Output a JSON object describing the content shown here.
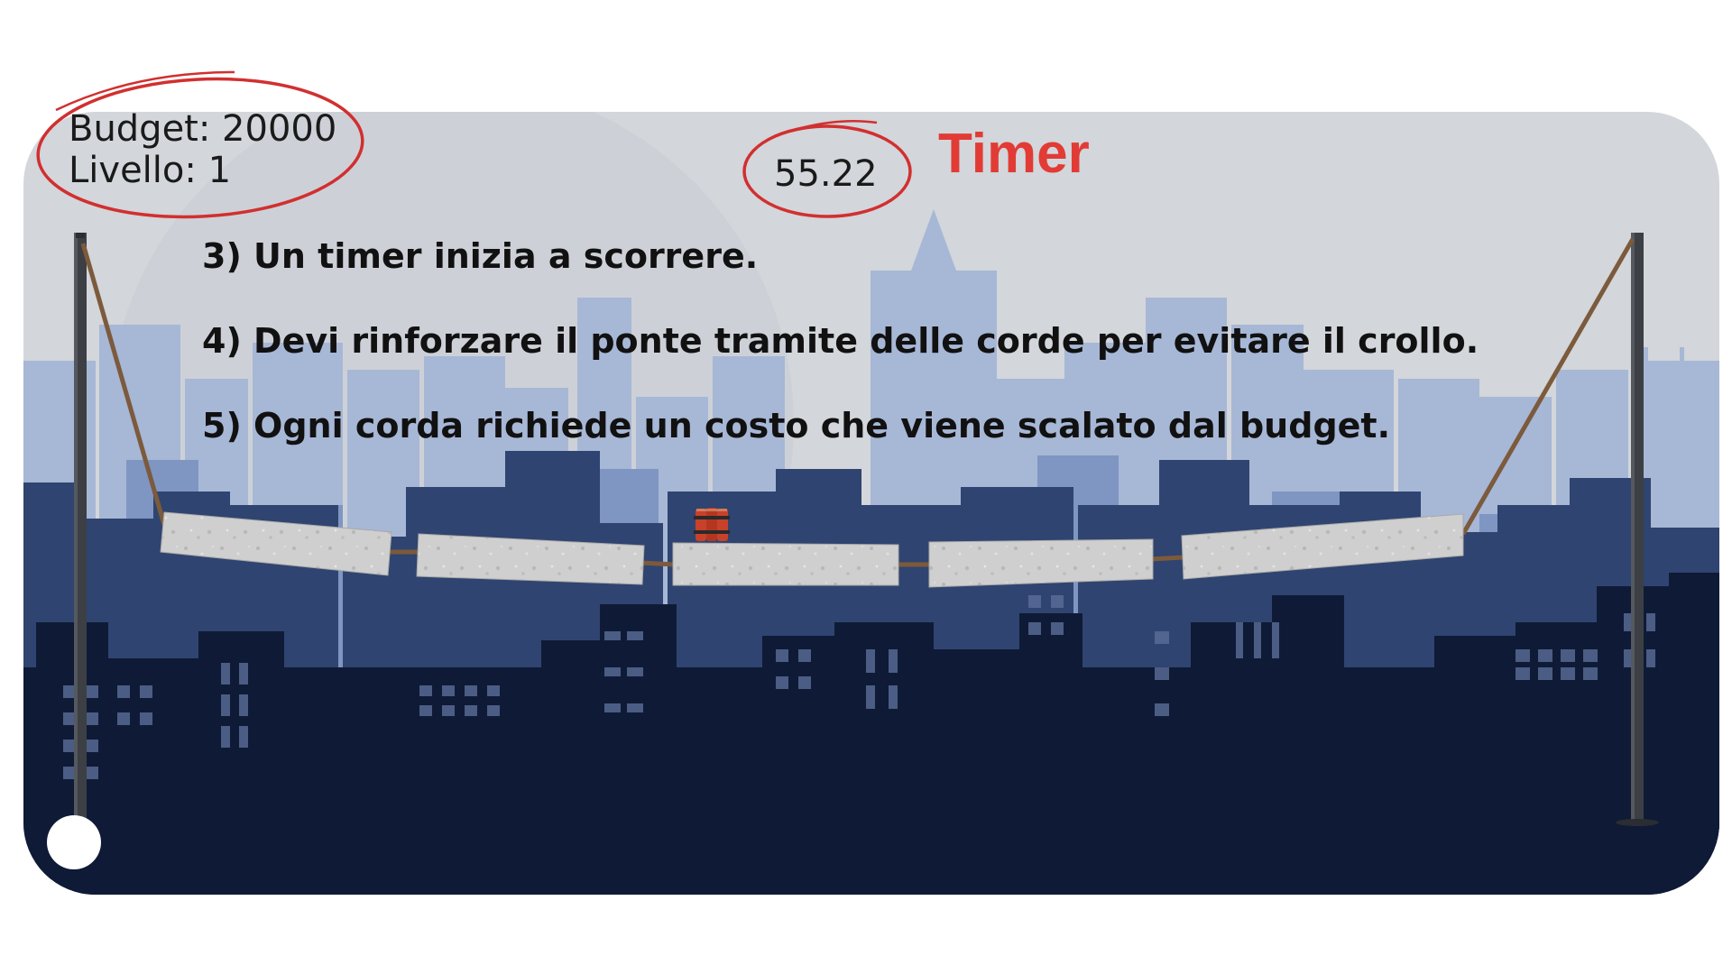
{
  "hud": {
    "budget_text": "Budget: 20000",
    "level_text": "Livello: 1",
    "timer_value": "55.22"
  },
  "annotation": {
    "timer_caption": "Timer",
    "accent_color": "#e23b36"
  },
  "instructions": [
    "3) Un timer inizia a scorrere.",
    "4) Devi rinforzare il ponte tramite delle corde per evitare il crollo.",
    "5) Ogni corda richiede un costo che viene scalato dal budget."
  ],
  "colors": {
    "sky": "#d3d6da",
    "city_far": "#a7b7d6",
    "city_mid": "#7f96c2",
    "city_near": "#2f4470",
    "city_front": "#0f1a36",
    "pole": "#3c3f44",
    "rope": "#7c5a3c",
    "plank": "#c9c9c9",
    "dynamite": "#c8412b"
  },
  "icons": {
    "dynamite": "dynamite-icon",
    "corner_control": "circle-button-icon"
  }
}
